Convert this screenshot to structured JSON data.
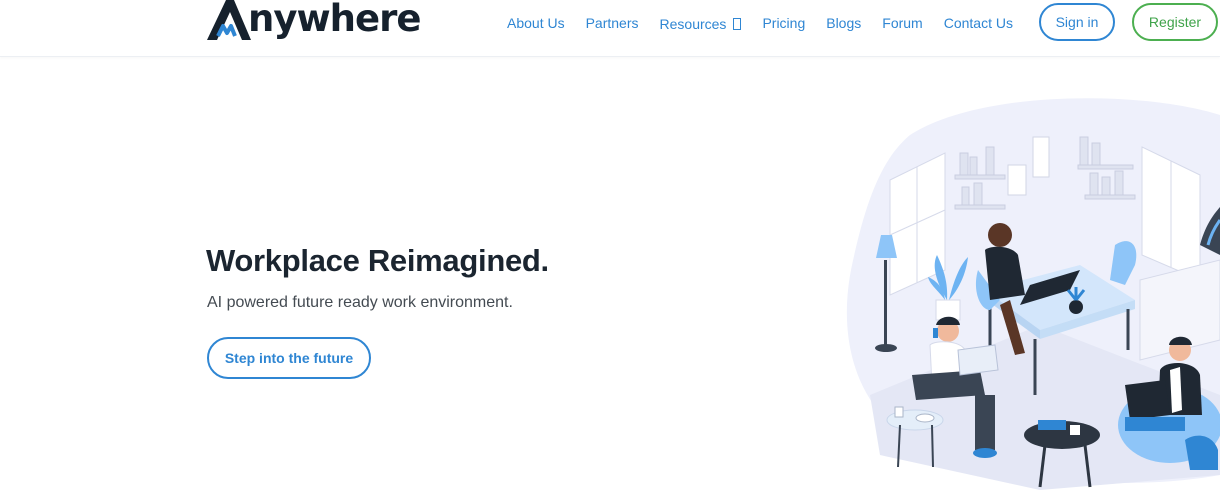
{
  "brand": {
    "name": "nywhere",
    "mark": "A"
  },
  "nav": {
    "links": [
      "About Us",
      "Partners",
      "Resources",
      "Pricing",
      "Blogs",
      "Forum",
      "Contact Us"
    ],
    "signin_label": "Sign in",
    "register_label": "Register"
  },
  "hero": {
    "title": "Workplace Reimagined.",
    "subtitle": "AI powered future ready work environment.",
    "cta_label": "Step into the future"
  },
  "colors": {
    "primary": "#2f86d3",
    "register": "#4caf50",
    "ink": "#1b2530",
    "illustration_blue": "#8ec5f8"
  }
}
